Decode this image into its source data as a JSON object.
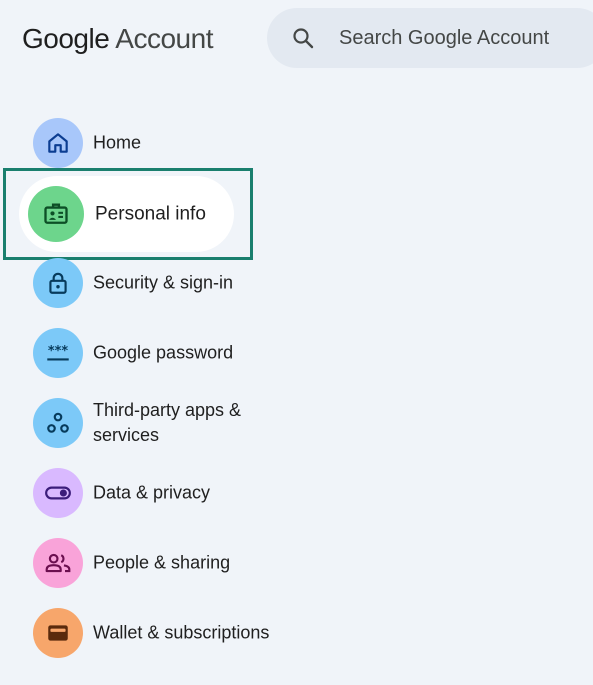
{
  "header": {
    "brand": "Google",
    "product": "Account",
    "search_placeholder": "Search Google Account"
  },
  "nav": {
    "items": [
      {
        "label": "Home",
        "icon": "home-icon",
        "color": "#a8c7fa"
      },
      {
        "label": "Personal info",
        "icon": "id-card-icon",
        "color": "#6dd58c",
        "selected": true
      },
      {
        "label": "Security & sign-in",
        "icon": "lock-icon",
        "color": "#7cc9f8"
      },
      {
        "label": "Google password",
        "icon": "password-icon",
        "color": "#7cc9f8"
      },
      {
        "label": "Third-party apps & services",
        "icon": "connections-icon",
        "color": "#7cc9f8"
      },
      {
        "label": "Data & privacy",
        "icon": "toggle-icon",
        "color": "#d9b9ff"
      },
      {
        "label": "People & sharing",
        "icon": "people-icon",
        "color": "#f9a3d9"
      },
      {
        "label": "Wallet & subscriptions",
        "icon": "wallet-icon",
        "color": "#f7a66b"
      }
    ]
  },
  "colors": {
    "background": "#f0f4f9",
    "selection_outline": "#1a7f6e"
  }
}
